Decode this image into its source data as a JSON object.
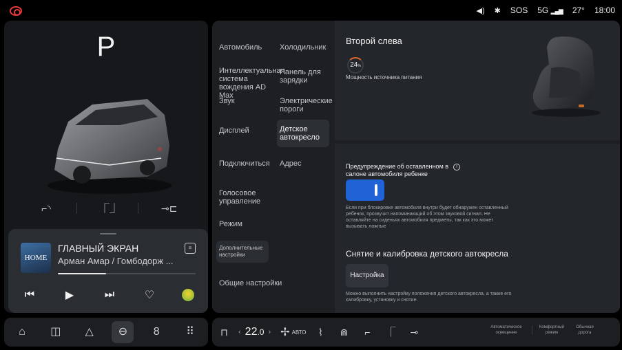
{
  "status_bar": {
    "left_icon": "parking-brake-warning-icon",
    "icons": [
      "volume-icon",
      "bluetooth-icon"
    ],
    "sos": "SOS",
    "network": "5G",
    "temperature": "27°",
    "time": "18:00",
    "accent": "#e53b3b"
  },
  "vehicle": {
    "gear": "P"
  },
  "quick_actions": [
    "mirror-fold-icon",
    "seat-icon",
    "charge-port-icon"
  ],
  "media": {
    "album_art_text": "HOME",
    "title": "ГЛАВНЫЙ ЭКРАН",
    "artist": "Арман Амар / Гомбодорж ...",
    "progress": 0.35,
    "controls": [
      "previous-icon",
      "play-icon",
      "next-icon",
      "favorite-icon",
      "app-icon"
    ]
  },
  "settings_menu": {
    "col1": [
      "Автомобиль",
      "Интеллектуальная система вождения AD Max",
      "Звук",
      "Дисплей",
      "Подключиться",
      "Голосовое управление",
      "Режим",
      "Дополнительные настройки",
      "Общие настройки"
    ],
    "col2": [
      "Холодильник",
      "Панель для зарядки",
      "Электрические пороги",
      "Детское автокресло",
      "Адрес"
    ],
    "active": "Детское автокресло"
  },
  "child_seat": {
    "title": "Второй слева",
    "power_value": "24",
    "power_unit": "%",
    "power_label": "Мощность источника питания",
    "warning_label": "Предупреждение об оставленном в салоне автомобиля ребенке",
    "warning_enabled": true,
    "warning_desc": "Если при блокировке автомобиля внутри будет обнаружен оставленный ребенок, прозвучит напоминающий об этом звуковой сигнал. Не оставляйте на сиденьях автомобиля предметы, так как это может вызывать ложные",
    "calibration_title": "Снятие и калибровка детского автокресла",
    "setup_button": "Настройка",
    "calibration_desc": "Можно выполнить настройку положения детского автокресла, а также его калибровку, установку и снятие.",
    "toggle_color": "#1f63d6"
  },
  "dock": {
    "items": [
      "home-icon",
      "media-icon",
      "navigation-icon",
      "car-icon",
      "phone-icon",
      "apps-icon"
    ],
    "active": "car-icon"
  },
  "climate": {
    "temp_main": "22",
    "temp_decimal": ".0",
    "fan_mode": "АВТО",
    "modes": [
      "Автоматическое освещение",
      "Комфортный режим",
      "Обычная дорога"
    ]
  }
}
